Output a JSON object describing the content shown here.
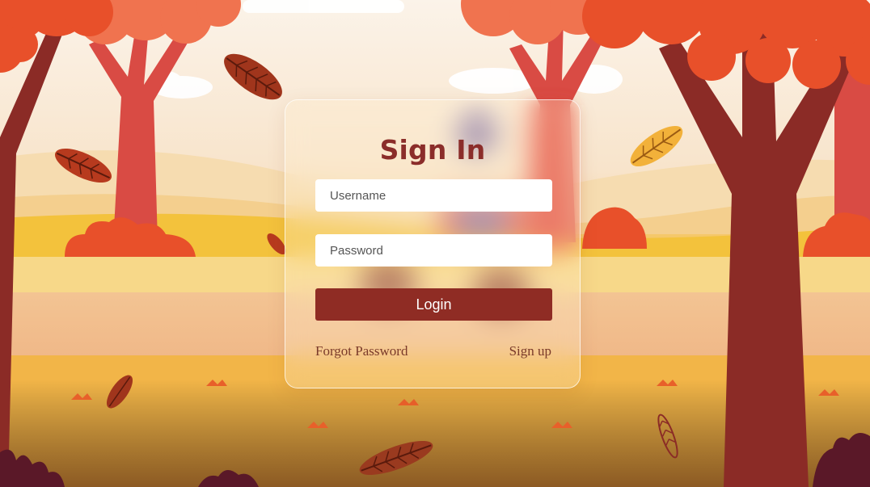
{
  "form": {
    "title": "Sign In",
    "username_placeholder": "Username",
    "password_placeholder": "Password",
    "login_label": "Login",
    "forgot_password_label": "Forgot Password",
    "signup_label": "Sign up"
  },
  "colors": {
    "accent": "#8f2c24",
    "title": "#8b2d2a",
    "link": "#7a3a2a",
    "tree_trunk": "#8b2b26",
    "foliage": "#e8502a",
    "ground": "#f2b843"
  }
}
